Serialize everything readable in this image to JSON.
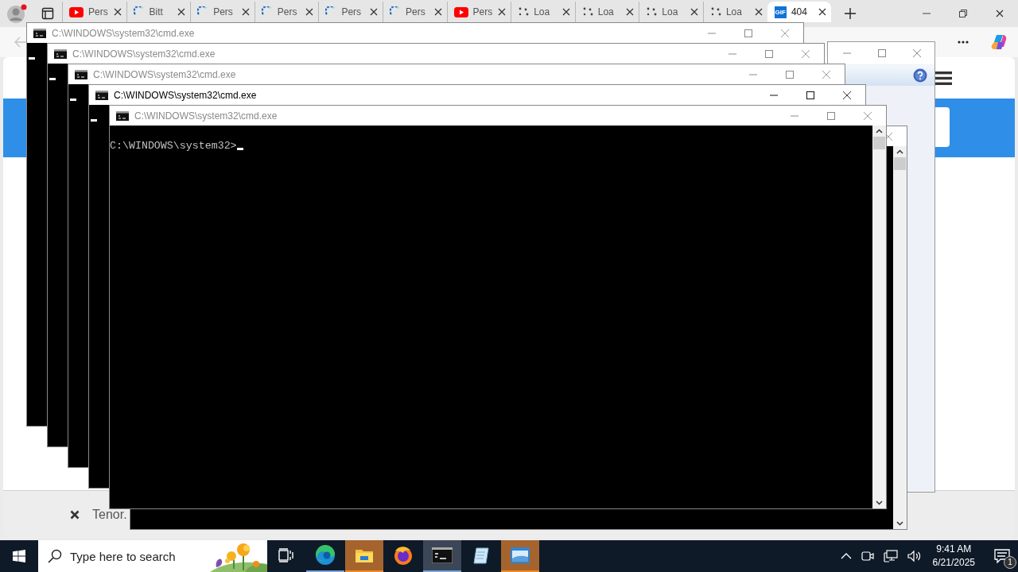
{
  "browser": {
    "tabs": [
      {
        "kind": "youtube",
        "label": "Pers",
        "selected": false
      },
      {
        "kind": "loading",
        "label": "Bitt",
        "selected": false
      },
      {
        "kind": "loading",
        "label": "Pers",
        "selected": false
      },
      {
        "kind": "loading",
        "label": "Pers",
        "selected": false
      },
      {
        "kind": "loading",
        "label": "Pers",
        "selected": false
      },
      {
        "kind": "loading",
        "label": "Pers",
        "selected": false
      },
      {
        "kind": "youtube",
        "label": "Pers",
        "selected": false
      },
      {
        "kind": "waiting",
        "label": "Loa",
        "selected": false
      },
      {
        "kind": "waiting",
        "label": "Loa",
        "selected": false
      },
      {
        "kind": "waiting",
        "label": "Loa",
        "selected": false
      },
      {
        "kind": "waiting",
        "label": "Loa",
        "selected": false
      },
      {
        "kind": "gif",
        "icon_text": "GIF",
        "label": "404",
        "selected": true
      }
    ],
    "bottom_bar": {
      "label": "Tenor."
    }
  },
  "consoles": [
    {
      "title": "C:\\WINDOWS\\system32\\cmd.exe",
      "focused": false
    },
    {
      "title": "C:\\WINDOWS\\system32\\cmd.exe",
      "focused": false
    },
    {
      "title": "C:\\WINDOWS\\system32\\cmd.exe",
      "focused": false
    },
    {
      "title": "C:\\WINDOWS\\system32\\cmd.exe",
      "focused": true
    },
    {
      "title": "C:\\WINDOWS\\system32\\cmd.exe",
      "focused": false,
      "prompt": "C:\\WINDOWS\\system32>"
    },
    {
      "focused": false
    }
  ],
  "taskbar": {
    "search": {
      "placeholder": "Type here to search"
    },
    "apps": [
      {
        "kind": "task-view",
        "running": false,
        "selected": false,
        "flashing": false
      },
      {
        "kind": "edge",
        "running": true,
        "selected": false,
        "flashing": false
      },
      {
        "kind": "explorer",
        "running": true,
        "selected": false,
        "flashing": true
      },
      {
        "kind": "firefox",
        "running": false,
        "selected": false,
        "flashing": false
      },
      {
        "kind": "console",
        "running": true,
        "selected": true,
        "flashing": false
      },
      {
        "kind": "notepad",
        "running": false,
        "selected": false,
        "flashing": false
      },
      {
        "kind": "window-app",
        "running": false,
        "selected": false,
        "flashing": true
      }
    ],
    "time": "9:41 AM",
    "date": "6/21/2025",
    "notifications": "1"
  }
}
